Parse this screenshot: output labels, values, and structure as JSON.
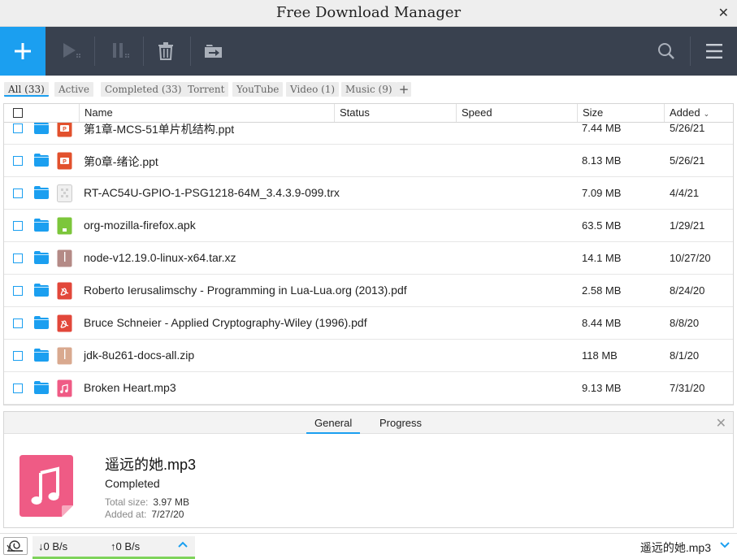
{
  "window": {
    "title": "Free Download Manager",
    "close": "✕"
  },
  "filters": [
    {
      "label": "All (33)",
      "active": true
    },
    {
      "label": "Active",
      "active": false
    },
    {
      "label": "Completed (33)",
      "active": false
    },
    {
      "label": "Torrent",
      "active": false
    },
    {
      "label": "YouTube",
      "active": false
    },
    {
      "label": "Video (1)",
      "active": false
    },
    {
      "label": "Music (9)",
      "active": false
    }
  ],
  "filters_add": "+",
  "table": {
    "columns": {
      "name": "Name",
      "status": "Status",
      "speed": "Speed",
      "size": "Size",
      "added": "Added"
    },
    "sort_indicator": "⌄",
    "rows": [
      {
        "name": "第1章-MCS-51单片机结构.ppt",
        "size": "7.44 MB",
        "added": "5/26/21",
        "type": "ppt"
      },
      {
        "name": "第0章-绪论.ppt",
        "size": "8.13 MB",
        "added": "5/26/21",
        "type": "ppt"
      },
      {
        "name": "RT-AC54U-GPIO-1-PSG1218-64M_3.4.3.9-099.trx",
        "size": "7.09 MB",
        "added": "4/4/21",
        "type": "generic"
      },
      {
        "name": "org-mozilla-firefox.apk",
        "size": "63.5 MB",
        "added": "1/29/21",
        "type": "apk"
      },
      {
        "name": "node-v12.19.0-linux-x64.tar.xz",
        "size": "14.1 MB",
        "added": "10/27/20",
        "type": "archive-dark"
      },
      {
        "name": "Roberto Ierusalimschy - Programming in Lua-Lua.org (2013).pdf",
        "size": "2.58 MB",
        "added": "8/24/20",
        "type": "pdf"
      },
      {
        "name": "Bruce Schneier - Applied Cryptography-Wiley (1996).pdf",
        "size": "8.44 MB",
        "added": "8/8/20",
        "type": "pdf"
      },
      {
        "name": "jdk-8u261-docs-all.zip",
        "size": "118 MB",
        "added": "8/1/20",
        "type": "archive"
      },
      {
        "name": "Broken Heart.mp3",
        "size": "9.13 MB",
        "added": "7/31/20",
        "type": "audio"
      }
    ]
  },
  "details": {
    "tabs": [
      {
        "label": "General",
        "active": true
      },
      {
        "label": "Progress",
        "active": false
      }
    ],
    "close": "✕",
    "file_name": "遥远的她.mp3",
    "status": "Completed",
    "total_size_label": "Total size:",
    "total_size": "3.97 MB",
    "added_label": "Added at:",
    "added": "7/27/20"
  },
  "statusbar": {
    "download_speed": "↓0 B/s",
    "upload_speed": "↑0 B/s",
    "current_file": "遥远的她.mp3"
  },
  "colors": {
    "accent": "#1b9ff0",
    "toolbar": "#39414f",
    "ppt": "#e2512d",
    "pdf": "#e2473a",
    "apk": "#7cc63b",
    "archive": "#d9a98f",
    "archive_dark": "#b48a86",
    "audio": "#ef5b85",
    "speed_ok": "#7ed35a"
  },
  "icons": {
    "add": "plus-icon",
    "resume": "play-icon",
    "pause": "pause-icon",
    "delete": "trash-icon",
    "move": "move-folder-icon",
    "search": "search-icon",
    "menu": "hamburger-menu-icon",
    "folder": "folder-icon",
    "snail": "snail-icon"
  }
}
